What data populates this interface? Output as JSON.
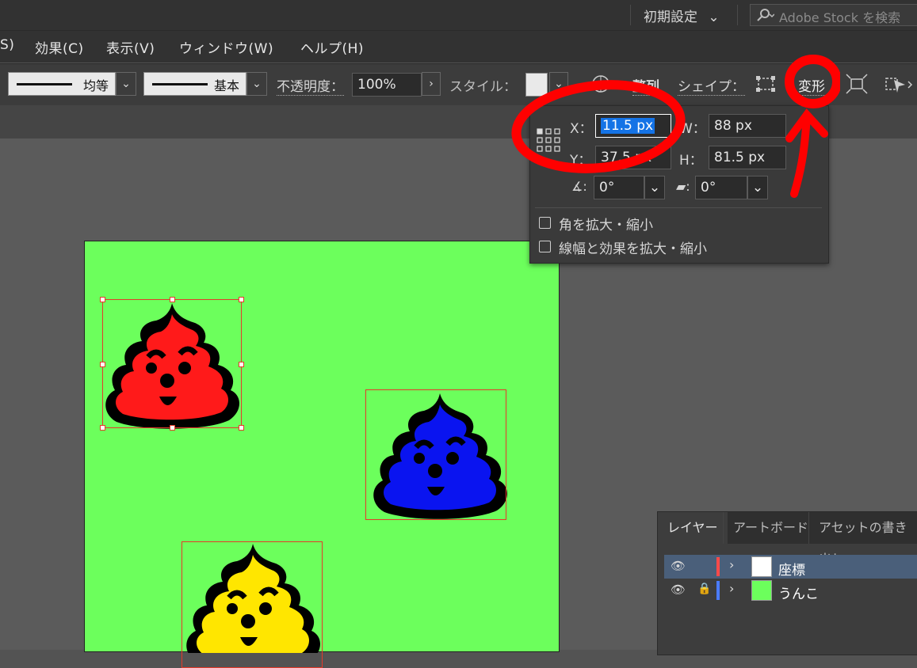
{
  "topbar": {
    "workspace_label": "初期設定",
    "search_placeholder": "Adobe Stock を検索"
  },
  "menu": {
    "items": [
      "S)",
      "効果(C)",
      "表示(V)",
      "ウィンドウ(W)",
      "ヘルプ(H)"
    ]
  },
  "control": {
    "stroke_profile": "均等",
    "brush": "基本",
    "opacity_label": "不透明度：",
    "opacity_value": "100%",
    "style_label": "スタイル：",
    "align_label": "整列",
    "shape_label": "シェイプ：",
    "transform_label": "変形"
  },
  "transform_panel": {
    "x_label": "X：",
    "x_value": "11.5 px",
    "y_label": "Y：",
    "y_value": "37.5 px",
    "w_label": "W：",
    "w_value": "88 px",
    "h_label": "H：",
    "h_value": "81.5 px",
    "rotate_value": "0°",
    "shear_value": "0°",
    "scale_corners_label": "角を拡大・縮小",
    "scale_strokes_label": "線幅と効果を拡大・縮小"
  },
  "layers_panel": {
    "tabs": [
      "レイヤー",
      "アートボード",
      "アセットの書き出し"
    ],
    "layers": [
      {
        "name": "座標",
        "color": "#ff4a4a",
        "locked": false,
        "selected": true
      },
      {
        "name": "うんこ",
        "color": "#4a7bff",
        "locked": true,
        "selected": false
      }
    ]
  },
  "colors": {
    "artboard": "#6cff5c",
    "selection": "#e53a2a",
    "annotation": "#ff0000",
    "poo_red": "#ff1a1a",
    "poo_blue": "#0a14f0",
    "poo_yellow": "#ffe600"
  }
}
